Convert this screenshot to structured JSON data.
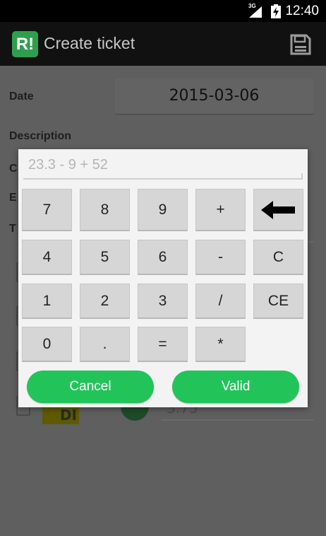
{
  "status_bar": {
    "network": "3G",
    "time": "12:40"
  },
  "action_bar": {
    "logo": "R!",
    "title": "Create ticket",
    "save_icon": "floppy-disk-icon"
  },
  "form": {
    "date_label": "Date",
    "date_value": "2015-03-06",
    "description_label": "Description",
    "partial_labels": [
      "C",
      "E",
      "T"
    ],
    "partial_tile_text": "DI",
    "partial_amount": "3.75"
  },
  "calculator": {
    "expression": "23.3 - 9 + 52",
    "keys": {
      "k7": "7",
      "k8": "8",
      "k9": "9",
      "plus": "+",
      "k4": "4",
      "k5": "5",
      "k6": "6",
      "minus": "-",
      "clear": "C",
      "k1": "1",
      "k2": "2",
      "k3": "3",
      "divide": "/",
      "clear_entry": "CE",
      "k0": "0",
      "dot": ".",
      "equals": "=",
      "multiply": "*"
    },
    "backspace_icon": "left-arrow-icon",
    "cancel_label": "Cancel",
    "valid_label": "Valid",
    "accent_color": "#22c45a"
  }
}
